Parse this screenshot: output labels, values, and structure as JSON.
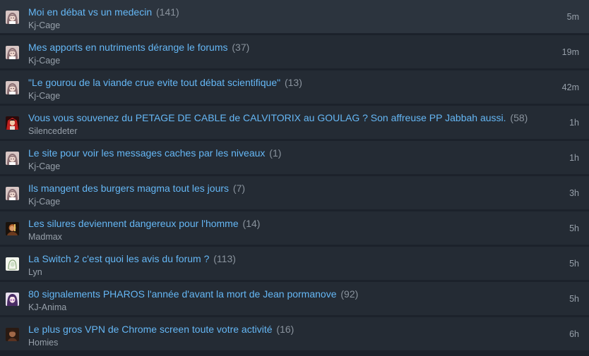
{
  "topics": [
    {
      "title": "Moi en débat vs un medecin",
      "replies": "141",
      "author": "Kj-Cage",
      "time": "5m",
      "avatar_icon": "anime-avatar-icon",
      "avatar_color": "#b59ca0"
    },
    {
      "title": "Mes apports en nutriments dérange le forums",
      "replies": "37",
      "author": "Kj-Cage",
      "time": "19m",
      "avatar_icon": "anime-avatar-icon",
      "avatar_color": "#b59ca0"
    },
    {
      "title": "\"Le gourou de la viande crue evite tout débat scientifique\"",
      "replies": "13",
      "author": "Kj-Cage",
      "time": "42m",
      "avatar_icon": "anime-avatar-icon",
      "avatar_color": "#b59ca0"
    },
    {
      "title": "Vous vous souvenez du PETAGE DE CABLE de CALVITORIX au GOULAG ? Son affreuse PP Jabbah aussi.",
      "replies": "58",
      "author": "Silencedeter",
      "time": "1h",
      "avatar_icon": "red-character-avatar-icon",
      "avatar_color": "#c0201e"
    },
    {
      "title": "Le site pour voir les messages caches par les niveaux",
      "replies": "1",
      "author": "Kj-Cage",
      "time": "1h",
      "avatar_icon": "anime-avatar-icon",
      "avatar_color": "#b59ca0"
    },
    {
      "title": "Ils mangent des burgers magma tout les jours",
      "replies": "7",
      "author": "Kj-Cage",
      "time": "3h",
      "avatar_icon": "anime-avatar-icon",
      "avatar_color": "#b59ca0"
    },
    {
      "title": "Les silures deviennent dangereux pour l'homme",
      "replies": "14",
      "author": "Madmax",
      "time": "5h",
      "avatar_icon": "dark-warrior-avatar-icon",
      "avatar_color": "#6b3a1e"
    },
    {
      "title": "La Switch 2 c'est quoi les avis du forum ?",
      "replies": "113",
      "author": "Lyn",
      "time": "5h",
      "avatar_icon": "green-sketch-avatar-icon",
      "avatar_color": "#cfe0c8"
    },
    {
      "title": "80 signalements PHAROS l'année d'avant la mort de Jean pormanove",
      "replies": "92",
      "author": "KJ-Anima",
      "time": "5h",
      "avatar_icon": "purple-anime-avatar-icon",
      "avatar_color": "#6a4c8a"
    },
    {
      "title": "Le plus gros VPN de Chrome screen toute votre activité",
      "replies": "16",
      "author": "Homies",
      "time": "6h",
      "avatar_icon": "brown-portrait-avatar-icon",
      "avatar_color": "#5a3322"
    }
  ]
}
